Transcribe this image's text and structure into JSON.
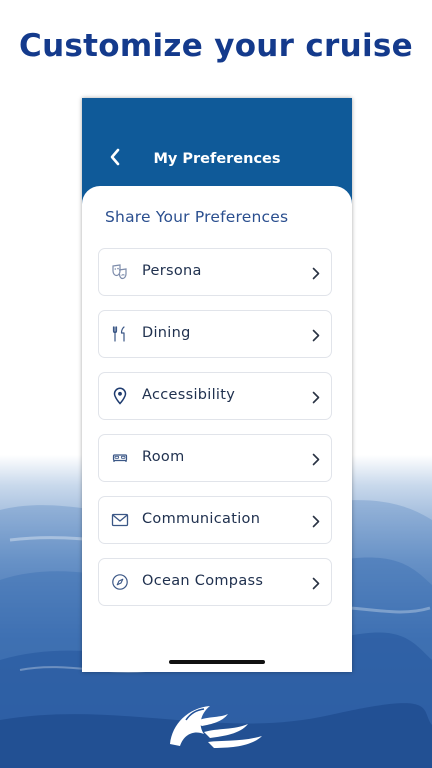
{
  "promo": {
    "headline": "Customize your cruise"
  },
  "header": {
    "title": "My Preferences",
    "back_icon": "chevron-left-icon"
  },
  "section": {
    "title": "Share Your Preferences"
  },
  "preferences": [
    {
      "label": "Persona",
      "icon": "theater-masks-icon"
    },
    {
      "label": "Dining",
      "icon": "fork-knife-icon"
    },
    {
      "label": "Accessibility",
      "icon": "location-pin-icon"
    },
    {
      "label": "Room",
      "icon": "bed-icon"
    },
    {
      "label": "Communication",
      "icon": "envelope-icon"
    },
    {
      "label": "Ocean Compass",
      "icon": "compass-icon"
    }
  ],
  "colors": {
    "headline": "#143a8c",
    "header_background": "#0f5a99",
    "section_title": "#2b4f8f",
    "item_text": "#20314f",
    "icon": "#3b5786",
    "item_border": "#e1e4ea",
    "ocean": "#1f4f97"
  },
  "brand": {
    "logo_icon": "princess-seawitch-logo-icon"
  }
}
